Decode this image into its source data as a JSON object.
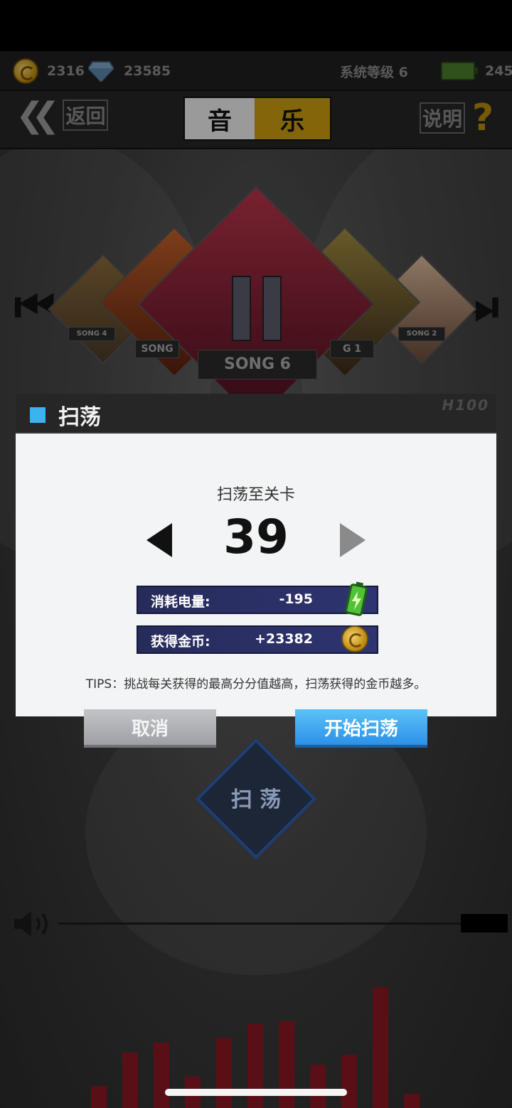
{
  "topbar": {
    "coins": "2316",
    "gems": "23585",
    "system_level": "系统等级 6",
    "energy": "245"
  },
  "nav": {
    "back_label": "返回",
    "tab_music_left": "音",
    "tab_music_right": "乐",
    "help_label": "说明",
    "help_icon": "?"
  },
  "carousel": {
    "songs": [
      "SONG 4",
      "SONG",
      "SONG 6",
      "G 1",
      "SONG 2"
    ]
  },
  "dialog": {
    "title": "扫荡",
    "deco_text": "H100",
    "sweep_to_label": "扫荡至关卡",
    "level": "39",
    "energy_cost_label": "消耗电量:",
    "energy_cost_value": "-195",
    "coins_gain_label": "获得金币:",
    "coins_gain_value": "+23382",
    "tips": "TIPS：挑战每关获得的最高分分值越高，扫荡获得的金币越多。",
    "cancel_label": "取消",
    "start_label": "开始扫荡"
  },
  "sweep_button_label": "扫 荡",
  "equalizer": {
    "levels": [
      0.09,
      0.23,
      0.27,
      0.13,
      0.29,
      0.35,
      0.36,
      0.18,
      0.22,
      0.5,
      0.06
    ]
  },
  "colors": {
    "accent_gold": "#c99c10",
    "accent_blue": "#3bb3ee",
    "start_button": "#2d91e8",
    "stat_bar": "#2e3470",
    "equalizer_bar": "#5a0f16"
  },
  "icons": {
    "coin": "coin-icon",
    "gem": "diamond-icon",
    "battery": "battery-icon",
    "back": "double-chevron-left-icon",
    "help": "question-mark-icon",
    "prev": "skip-previous-icon",
    "next": "skip-next-icon",
    "pause": "pause-icon",
    "volume": "speaker-icon"
  }
}
